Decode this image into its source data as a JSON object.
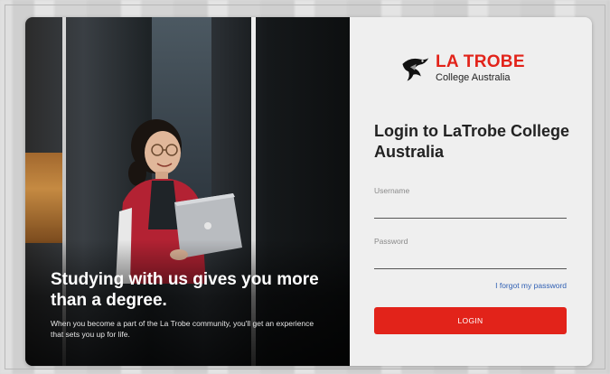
{
  "hero": {
    "headline": "Studying with us gives you more than a degree.",
    "subtext": "When you become a part of the La Trobe community, you'll get an experience that sets you up for life."
  },
  "brand": {
    "name": "LA TROBE",
    "subname": "College Australia",
    "logo_icon": "eagle-icon",
    "accent_color": "#e2231a"
  },
  "form": {
    "title": "Login to LaTrobe College Australia",
    "username_label": "Username",
    "username_value": "",
    "password_label": "Password",
    "password_value": "",
    "forgot_link": "I forgot my password",
    "login_button": "LOGIN"
  }
}
